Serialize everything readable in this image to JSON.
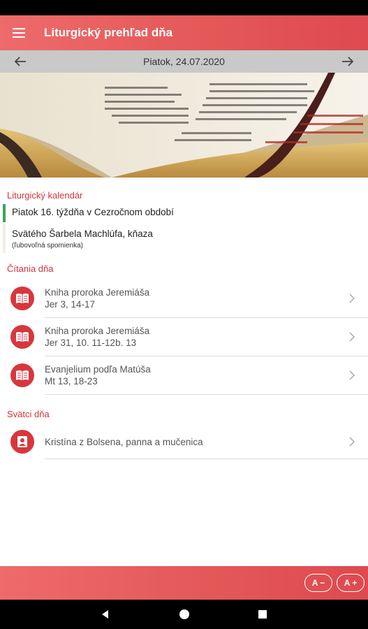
{
  "appbar": {
    "title": "Liturgický prehľad dňa",
    "menu_icon": "menu-icon"
  },
  "datebar": {
    "date": "Piatok, 24.07.2020",
    "prev_icon": "arrow-left-icon",
    "next_icon": "arrow-right-icon"
  },
  "calendar": {
    "title": "Liturgický kalendár",
    "items": [
      {
        "main": "Piatok 16. týždňa v Cezročnom období",
        "sub": "",
        "accent": "#3fa45a"
      },
      {
        "main": "Svätého Šarbela Machlúfa, kňaza",
        "sub": "(ľubovoľná spomienka)",
        "accent": "#f3ece6"
      }
    ]
  },
  "readings": {
    "title": "Čítania dňa",
    "items": [
      {
        "title": "Kniha proroka Jeremiáša",
        "ref": "Jer 3, 14-17",
        "icon": "book-icon"
      },
      {
        "title": "Kniha proroka Jeremiáša",
        "ref": "Jer 31, 10. 11-12b. 13",
        "icon": "book-icon"
      },
      {
        "title": "Evanjelium podľa Matúša",
        "ref": "Mt 13, 18-23",
        "icon": "book-icon"
      }
    ]
  },
  "saints": {
    "title": "Svätci dňa",
    "items": [
      {
        "name": "Kristína z Bolsena, panna a mučenica",
        "icon": "person-icon"
      }
    ]
  },
  "bottombar": {
    "font_decrease": "A −",
    "font_increase": "A +"
  },
  "colors": {
    "accent": "#d8363d",
    "header_gradient_start": "#ee6b6b",
    "header_gradient_end": "#de4a4f"
  }
}
